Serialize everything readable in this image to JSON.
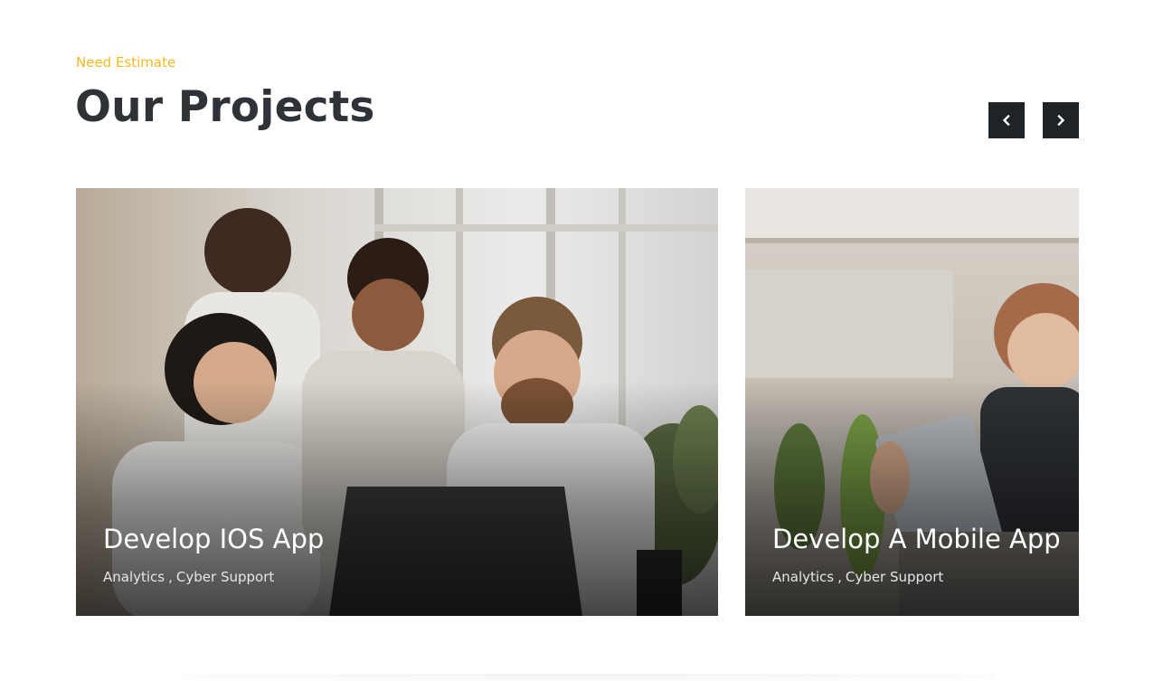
{
  "section": {
    "eyebrow": "Need Estimate",
    "title": "Our Projects"
  },
  "nav": {
    "prev_icon": "chevron-left-icon",
    "next_icon": "chevron-right-icon"
  },
  "projects": [
    {
      "title": "Develop IOS App",
      "tags": [
        "Analytics",
        "Cyber Support"
      ],
      "image": "photo of team celebrating at laptop"
    },
    {
      "title": "Develop A Mobile App",
      "tags": [
        "Analytics",
        "Cyber Support"
      ],
      "image": "photo of woman with tablet in office"
    }
  ],
  "colors": {
    "accent": "#f5b921",
    "heading": "#2f3237",
    "button_bg": "#1e2328"
  }
}
